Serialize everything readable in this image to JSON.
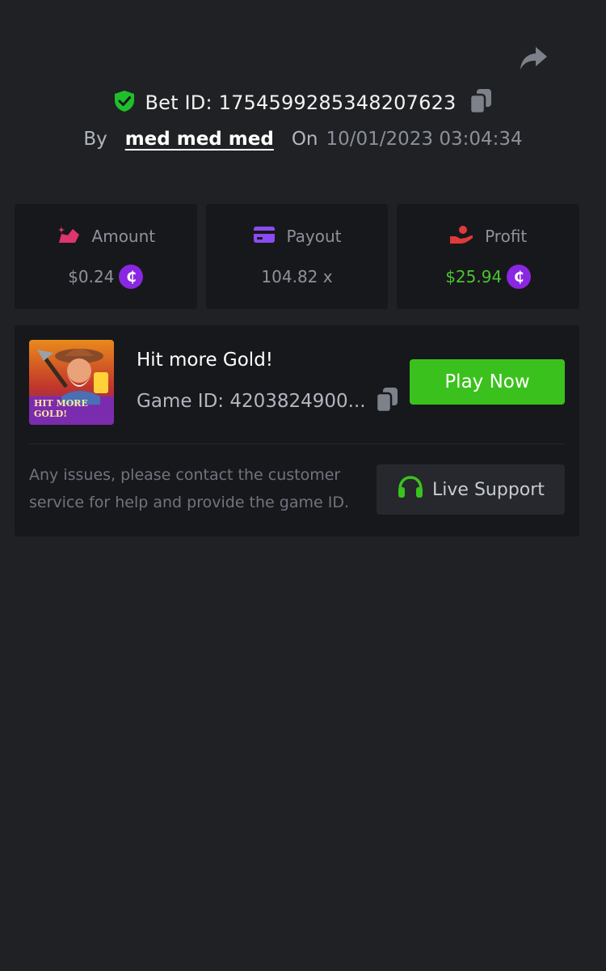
{
  "header": {
    "share_icon": "share-arrow-icon",
    "shield_icon": "verified-shield-icon",
    "bet_label": "Bet ID: ",
    "bet_id": "1754599285348207623",
    "copy_icon": "copy-icon",
    "by_label": "By",
    "username": "med med med",
    "on_label": "On",
    "date": "10/01/2023 03:04:34"
  },
  "stats": {
    "amount": {
      "label": "Amount",
      "value": "$0.24",
      "icon": "bet-chips-icon"
    },
    "payout": {
      "label": "Payout",
      "value": "104.82 x",
      "icon": "card-icon"
    },
    "profit": {
      "label": "Profit",
      "value": "$25.94",
      "icon": "hand-profit-icon"
    },
    "coin_symbol": "₵"
  },
  "game": {
    "title": "Hit more Gold!",
    "game_id": "Game ID: 4203824900...",
    "thumbnail_text_1": "HIT MORE",
    "thumbnail_text_2": "GOLD!",
    "play_label": "Play Now"
  },
  "support": {
    "help_text": "Any issues, please contact the customer service for help and provide the game ID.",
    "button_label": "Live Support",
    "icon": "headset-icon"
  },
  "colors": {
    "background": "#202124",
    "card": "#17181b",
    "accent_green": "#3bc11d",
    "profit_green": "#4ac430",
    "coin_purple": "#8a27e0",
    "amount_pink": "#e0356c",
    "payout_purple": "#8a4cf0",
    "profit_red": "#e03a3a"
  }
}
